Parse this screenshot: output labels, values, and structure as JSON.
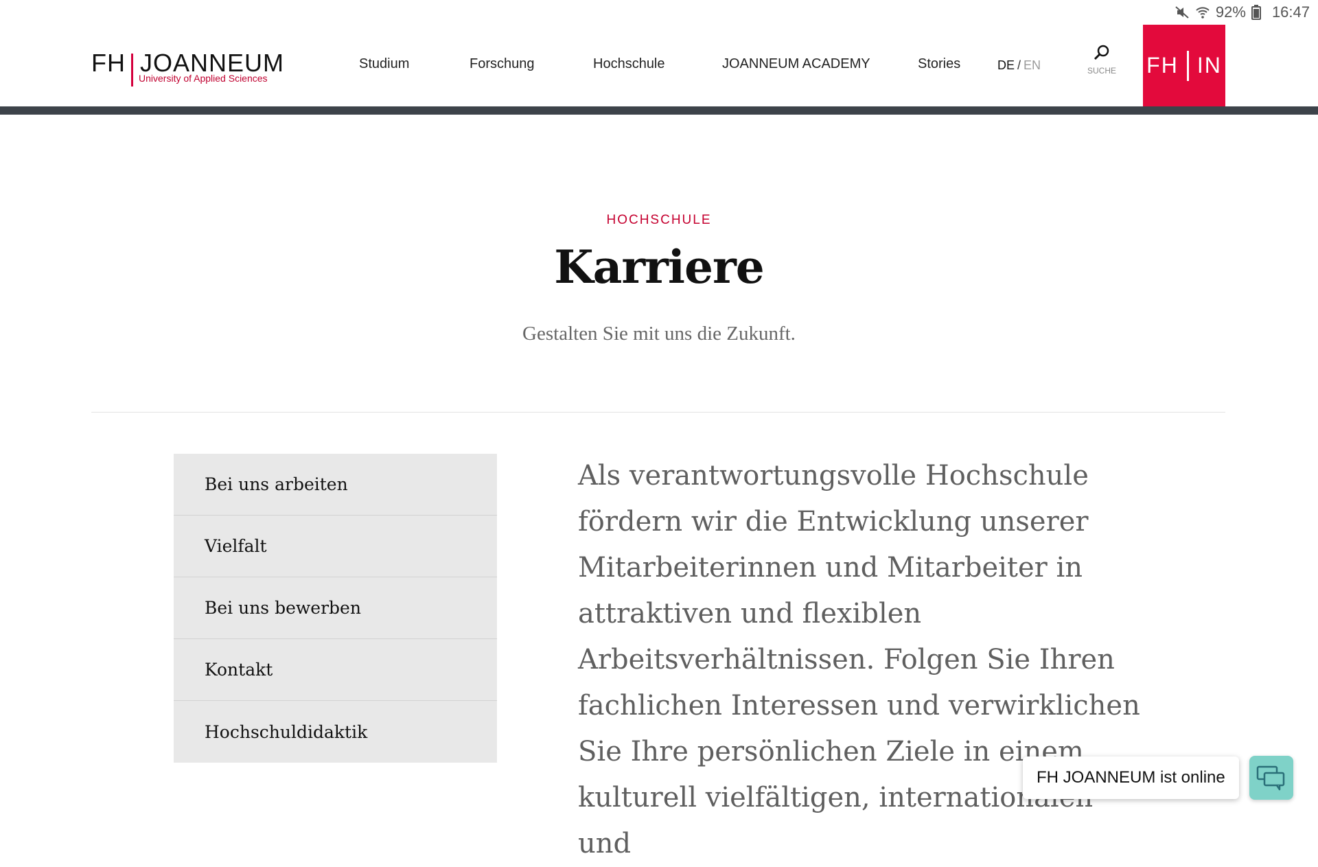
{
  "status_bar": {
    "battery": "92%",
    "time": "16:47",
    "icons": [
      "mute-icon",
      "wifi-icon",
      "battery-icon"
    ]
  },
  "header": {
    "logo_main_left": "FH",
    "logo_main_right": "JOANNEUM",
    "logo_sub": "University of Applied Sciences",
    "nav": [
      "Studium",
      "Forschung",
      "Hochschule",
      "JOANNEUM ACADEMY",
      "Stories"
    ],
    "lang_active": "DE",
    "lang_sep": "/",
    "lang_other": "EN",
    "search_label": "SUCHE",
    "fhin_left": "FH",
    "fhin_right": "IN"
  },
  "hero": {
    "kicker": "HOCHSCHULE",
    "title": "Karriere",
    "subtitle": "Gestalten Sie mit uns die Zukunft."
  },
  "side_menu": [
    "Bei uns arbeiten",
    "Vielfalt",
    "Bei uns bewerben",
    "Kontakt",
    "Hochschuldidaktik"
  ],
  "intro_text": "Als verantwortungsvolle Hochschule fördern wir die Entwicklung unserer Mitarbeiterinnen und Mitarbeiter in attraktiven und flexiblen Arbeitsverhältnissen. Folgen Sie Ihren fachlichen Interessen und verwirklichen Sie Ihre persönlichen Ziele in einem kulturell vielfältigen, internationalen und",
  "chat": {
    "status": "FH JOANNEUM ist online"
  },
  "colors": {
    "accent_red": "#e30a3c",
    "header_bar": "#3d434a",
    "chat_teal": "#7fd2c8",
    "menu_bg": "#e8e8e8"
  }
}
